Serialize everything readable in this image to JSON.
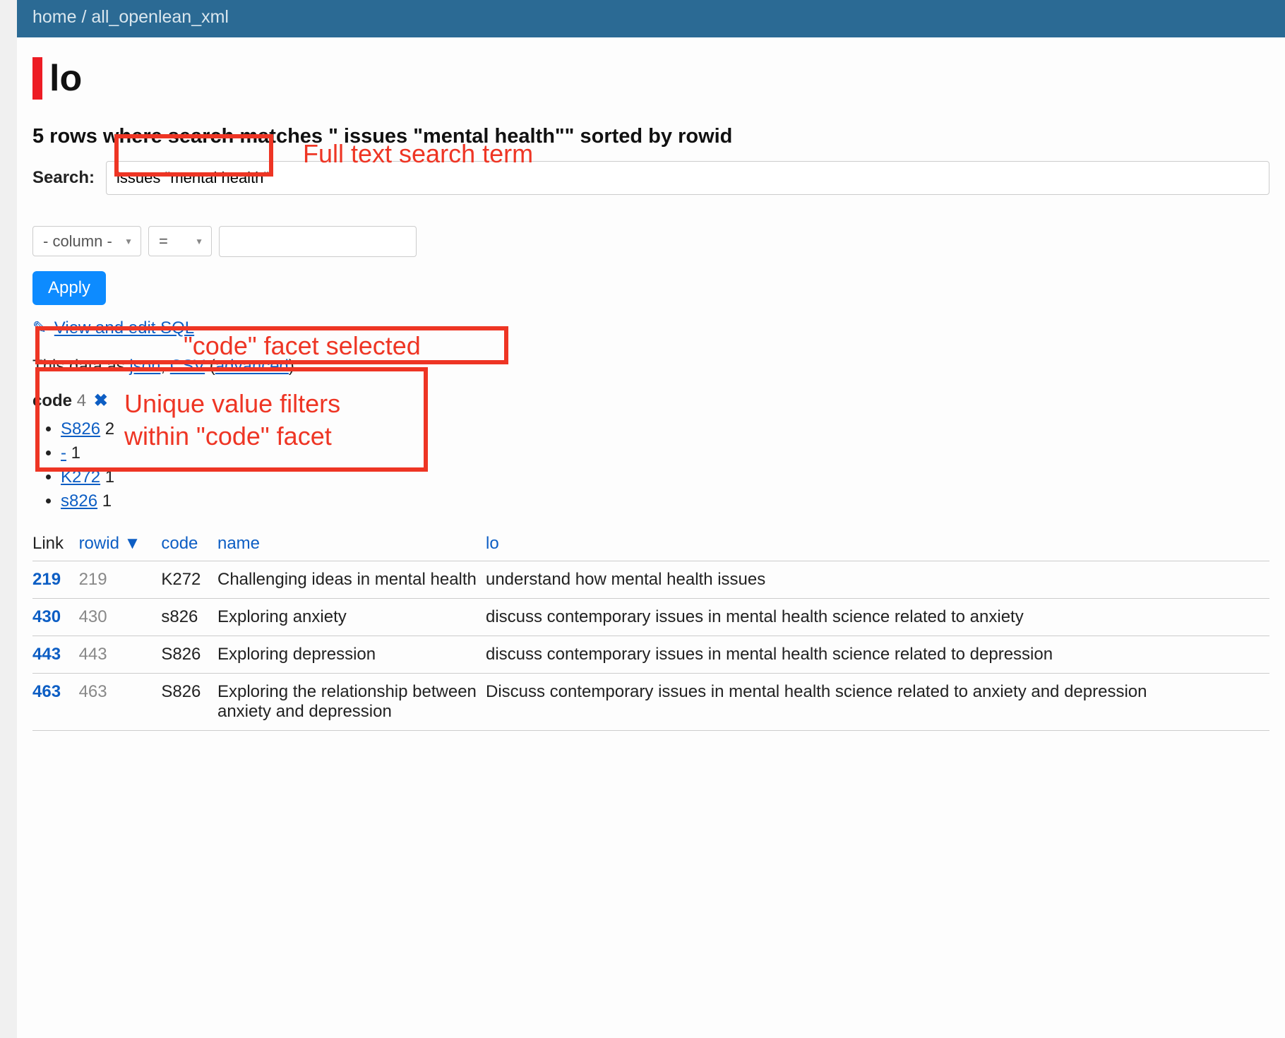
{
  "breadcrumb": {
    "home": "home",
    "db": "all_openlean_xml"
  },
  "title": "lo",
  "summary": "5 rows where search matches \" issues \"mental health\"\" sorted by rowid",
  "search": {
    "label": "Search:",
    "value": "issues \"mental health\""
  },
  "filter": {
    "column_placeholder": "- column -",
    "op_placeholder": "=",
    "value": ""
  },
  "apply_label": "Apply",
  "sql_link": "View and edit SQL",
  "export": {
    "prefix": "This data as ",
    "json": "json",
    "csv": "CSV",
    "advanced": "advanced"
  },
  "facet": {
    "name": "code",
    "count": "4",
    "remove_glyph": "✖",
    "items": [
      {
        "label": "S826",
        "count": "2"
      },
      {
        "label": "-",
        "count": "1"
      },
      {
        "label": "K272",
        "count": "1"
      },
      {
        "label": "s826",
        "count": "1"
      }
    ]
  },
  "columns": {
    "link": "Link",
    "rowid": "rowid",
    "sort_arrow": "▼",
    "code": "code",
    "name": "name",
    "lo": "lo"
  },
  "rows": [
    {
      "link": "219",
      "rowid": "219",
      "code": "K272",
      "name": "Challenging ideas in mental health",
      "lo": "understand how mental health issues"
    },
    {
      "link": "430",
      "rowid": "430",
      "code": "s826",
      "name": "Exploring anxiety",
      "lo": "discuss contemporary issues in mental health science related to anxiety"
    },
    {
      "link": "443",
      "rowid": "443",
      "code": "S826",
      "name": "Exploring depression",
      "lo": "discuss contemporary issues in mental health science related to depression"
    },
    {
      "link": "463",
      "rowid": "463",
      "code": "S826",
      "name": "Exploring the relationship between anxiety and depression",
      "lo": "Discuss contemporary issues in mental health science related to anxiety and depression"
    }
  ],
  "annotations": {
    "search_term": "Full text search term",
    "facet_selected": "\"code\" facet selected",
    "facet_values_l1": "Unique value filters",
    "facet_values_l2": "within \"code\" facet"
  }
}
